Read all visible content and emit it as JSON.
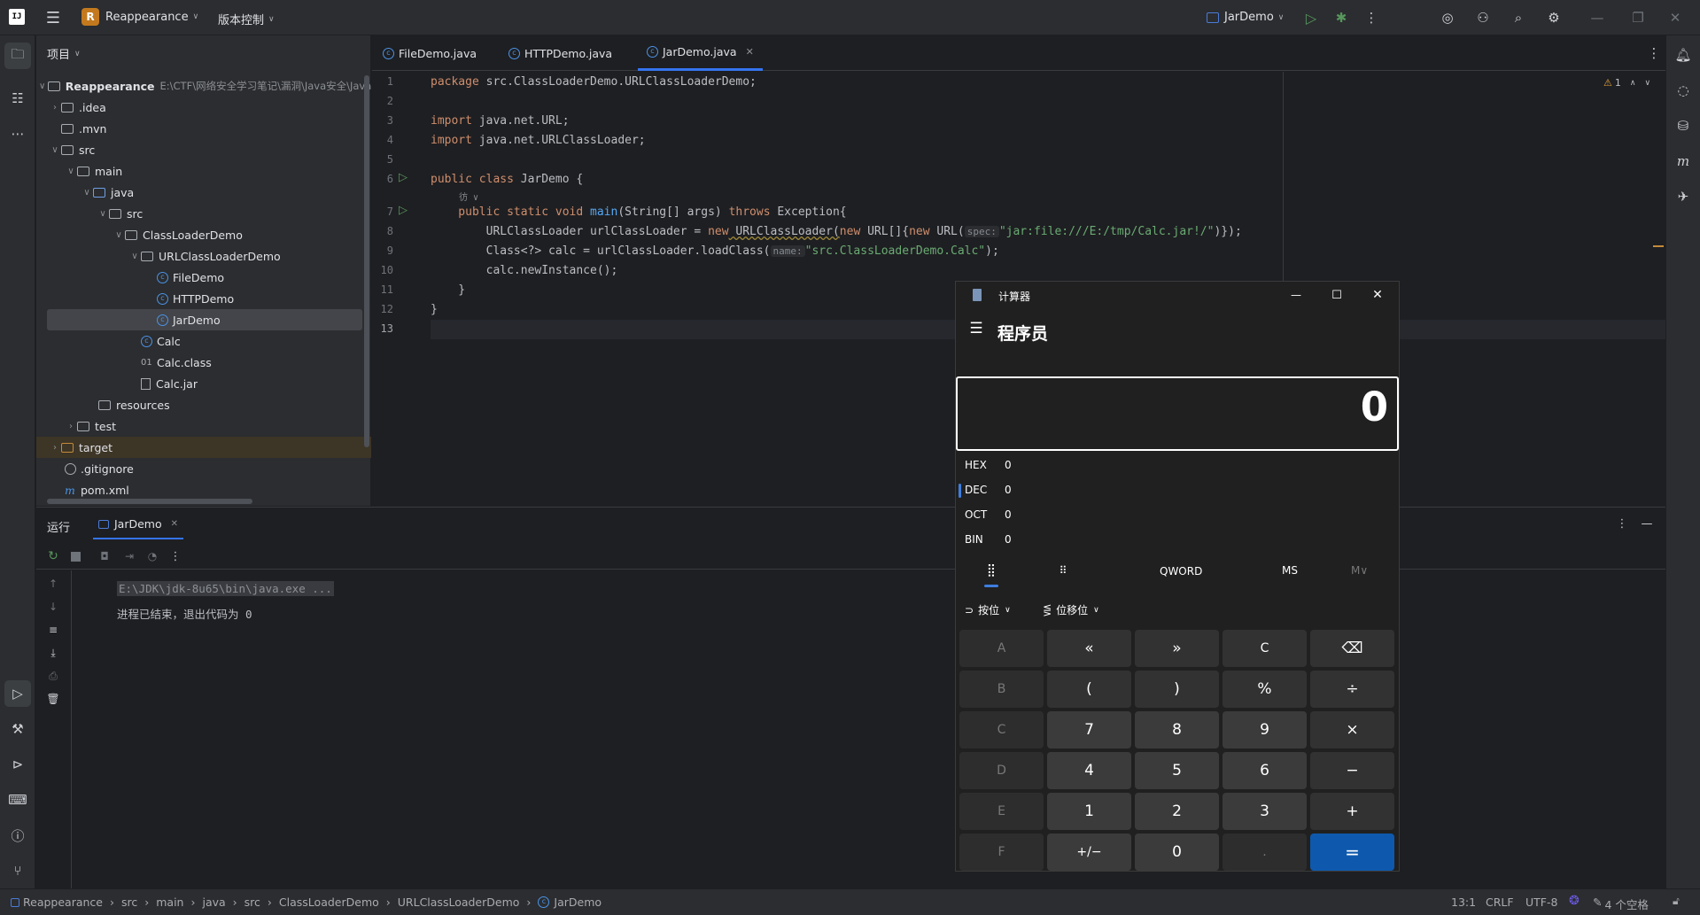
{
  "titlebar": {
    "project_badge": "R",
    "project_name": "Reappearance",
    "vcs_menu": "版本控制",
    "run_config": "JarDemo"
  },
  "project_panel": {
    "title": "项目",
    "root_name": "Reappearance",
    "root_path": "E:\\CTF\\网络安全学习笔记\\漏洞\\Java安全\\Java安",
    "items": [
      {
        "label": ".idea"
      },
      {
        "label": ".mvn"
      },
      {
        "label": "src"
      },
      {
        "label": "main"
      },
      {
        "label": "java"
      },
      {
        "label": "src"
      },
      {
        "label": "ClassLoaderDemo"
      },
      {
        "label": "URLClassLoaderDemo"
      },
      {
        "label": "FileDemo"
      },
      {
        "label": "HTTPDemo"
      },
      {
        "label": "JarDemo"
      },
      {
        "label": "Calc"
      },
      {
        "label": "Calc.class"
      },
      {
        "label": "Calc.jar"
      },
      {
        "label": "resources"
      },
      {
        "label": "test"
      },
      {
        "label": "target"
      },
      {
        "label": ".gitignore"
      },
      {
        "label": "pom.xml"
      }
    ]
  },
  "editor": {
    "tabs": [
      {
        "label": "FileDemo.java"
      },
      {
        "label": "HTTPDemo.java"
      },
      {
        "label": "JarDemo.java"
      }
    ],
    "warnings": "1",
    "line_numbers": [
      "1",
      "2",
      "3",
      "4",
      "5",
      "6",
      "7",
      "8",
      "9",
      "10",
      "11",
      "12",
      "13"
    ],
    "code": {
      "l1_kw": "package",
      "l1_rest": " src.ClassLoaderDemo.URLClassLoaderDemo;",
      "l3_kw": "import",
      "l3_rest": " java.net.URL;",
      "l4_kw": "import",
      "l4_rest": " java.net.URLClassLoader;",
      "l6_kw": "public class",
      "l6_rest": " JarDemo {",
      "author_hint": "彷",
      "l7_kw1": "    public static void",
      "l7_fn": " main",
      "l7_mid": "(String[] args) ",
      "l7_kw2": "throws",
      "l7_rest": " Exception{",
      "l8_a": "        URLClassLoader urlClassLoader = ",
      "l8_kw": "new",
      "l8_b": " URLClassLoader(",
      "l8_kw2": "new",
      "l8_c": " URL[]{",
      "l8_kw3": "new",
      "l8_d": " URL(",
      "l8_hint": "spec:",
      "l8_str": "\"jar:file:///E:/tmp/Calc.jar!/\"",
      "l8_e": ")});",
      "l9_a": "        Class<?> calc = urlClassLoader.loadClass(",
      "l9_hint": "name:",
      "l9_str": "\"src.ClassLoaderDemo.Calc\"",
      "l9_e": ");",
      "l10": "        calc.newInstance();",
      "l11": "    }",
      "l12": "}"
    }
  },
  "run_panel": {
    "title": "运行",
    "tab": "JarDemo",
    "cmd_line": "E:\\JDK\\jdk-8u65\\bin\\java.exe ...",
    "exit_line": "进程已结束，退出代码为 0"
  },
  "statusbar": {
    "breadcrumbs": [
      "Reappearance",
      "src",
      "main",
      "java",
      "src",
      "ClassLoaderDemo",
      "URLClassLoaderDemo",
      "JarDemo"
    ],
    "position": "13:1",
    "line_sep": "CRLF",
    "encoding": "UTF-8",
    "indent": "4 个空格"
  },
  "calculator": {
    "window_title": "计算器",
    "mode": "程序员",
    "display": "0",
    "radix": [
      {
        "label": "HEX",
        "value": "0"
      },
      {
        "label": "DEC",
        "value": "0"
      },
      {
        "label": "OCT",
        "value": "0"
      },
      {
        "label": "BIN",
        "value": "0"
      }
    ],
    "word_size": "QWORD",
    "ms": "MS",
    "mv": "M∨",
    "bitwise": "按位",
    "bitshift": "位移位",
    "keys": [
      [
        "A",
        "«",
        "»",
        "C",
        "⌫"
      ],
      [
        "B",
        "(",
        ")",
        "%",
        "÷"
      ],
      [
        "C",
        "7",
        "8",
        "9",
        "×"
      ],
      [
        "D",
        "4",
        "5",
        "6",
        "−"
      ],
      [
        "E",
        "1",
        "2",
        "3",
        "+"
      ],
      [
        "F",
        "+/−",
        "0",
        ".",
        "="
      ]
    ]
  }
}
